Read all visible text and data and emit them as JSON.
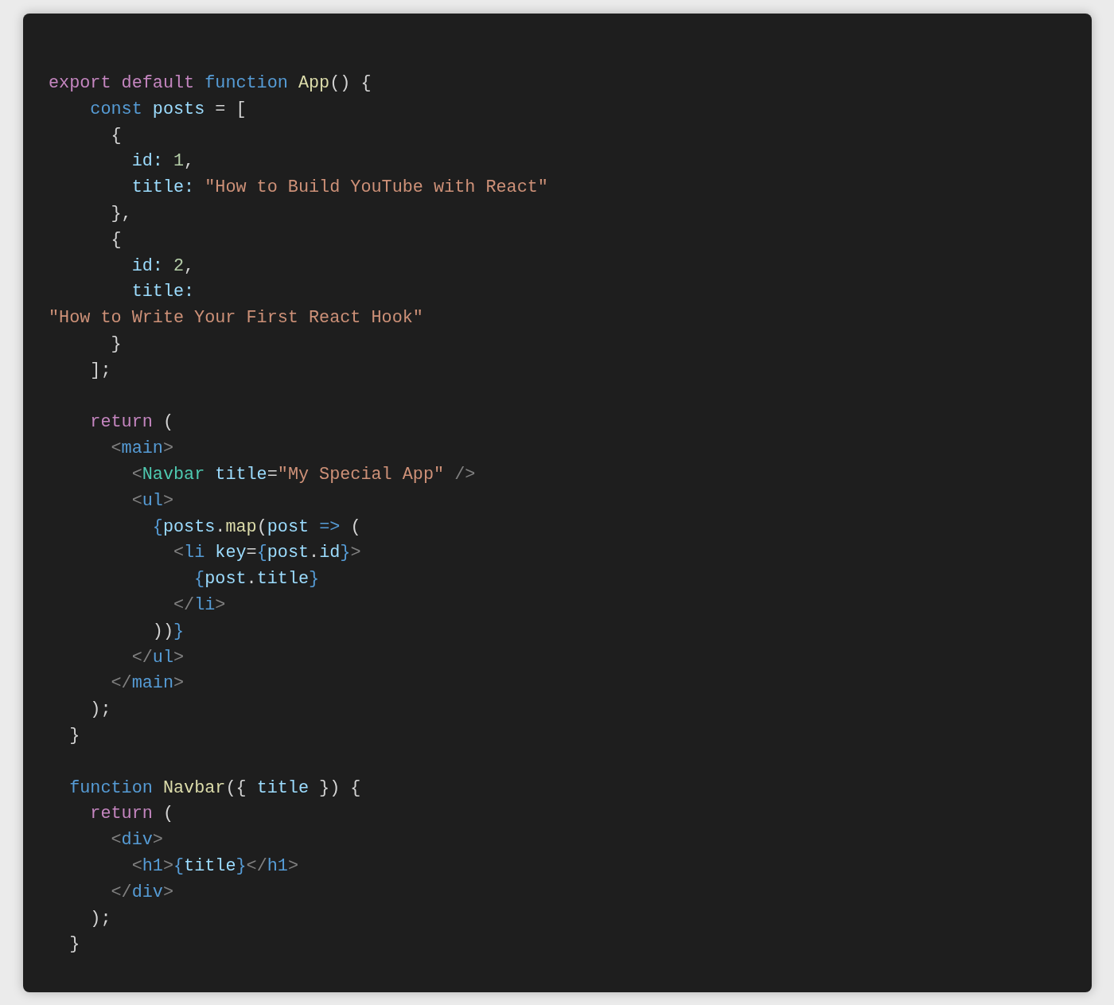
{
  "code_lines": [
    {
      "tokens": [
        {
          "kind": "kw",
          "text": "export default "
        },
        {
          "kind": "decl",
          "text": "function "
        },
        {
          "kind": "fn",
          "text": "App"
        },
        {
          "kind": "punc",
          "text": "() {"
        }
      ]
    },
    {
      "tokens": [
        {
          "kind": "decl",
          "text": "    const "
        },
        {
          "kind": "var",
          "text": "posts"
        },
        {
          "kind": "punc",
          "text": " = ["
        }
      ]
    },
    {
      "tokens": [
        {
          "kind": "punc",
          "text": "      {"
        }
      ]
    },
    {
      "tokens": [
        {
          "kind": "var",
          "text": "        id: "
        },
        {
          "kind": "num",
          "text": "1"
        },
        {
          "kind": "punc",
          "text": ","
        }
      ]
    },
    {
      "tokens": [
        {
          "kind": "var",
          "text": "        title: "
        },
        {
          "kind": "str",
          "text": "\"How to Build YouTube with React\""
        }
      ]
    },
    {
      "tokens": [
        {
          "kind": "punc",
          "text": "      },"
        }
      ]
    },
    {
      "tokens": [
        {
          "kind": "punc",
          "text": "      {"
        }
      ]
    },
    {
      "tokens": [
        {
          "kind": "var",
          "text": "        id: "
        },
        {
          "kind": "num",
          "text": "2"
        },
        {
          "kind": "punc",
          "text": ","
        }
      ]
    },
    {
      "tokens": [
        {
          "kind": "var",
          "text": "        title:"
        }
      ]
    },
    {
      "tokens": [
        {
          "kind": "str",
          "text": "\"How to Write Your First React Hook\""
        }
      ]
    },
    {
      "tokens": [
        {
          "kind": "punc",
          "text": "      }"
        }
      ]
    },
    {
      "tokens": [
        {
          "kind": "punc",
          "text": "    ];"
        }
      ]
    },
    {
      "blank_line_before": true,
      "tokens": [
        {
          "kind": "kw",
          "text": "    return"
        },
        {
          "kind": "punc",
          "text": " ("
        }
      ]
    },
    {
      "tokens": [
        {
          "kind": "tagp",
          "text": "      <"
        },
        {
          "kind": "tag",
          "text": "main"
        },
        {
          "kind": "tagp",
          "text": ">"
        }
      ]
    },
    {
      "tokens": [
        {
          "kind": "tagp",
          "text": "        <"
        },
        {
          "kind": "comp",
          "text": "Navbar"
        },
        {
          "kind": "attr",
          "text": " title"
        },
        {
          "kind": "punc",
          "text": "="
        },
        {
          "kind": "str",
          "text": "\"My Special App\""
        },
        {
          "kind": "tagp",
          "text": " />"
        }
      ]
    },
    {
      "tokens": [
        {
          "kind": "tagp",
          "text": "        <"
        },
        {
          "kind": "tag",
          "text": "ul"
        },
        {
          "kind": "tagp",
          "text": ">"
        }
      ]
    },
    {
      "tokens": [
        {
          "kind": "brace",
          "text": "          {"
        },
        {
          "kind": "var",
          "text": "posts"
        },
        {
          "kind": "punc",
          "text": "."
        },
        {
          "kind": "fn",
          "text": "map"
        },
        {
          "kind": "punc",
          "text": "("
        },
        {
          "kind": "var",
          "text": "post"
        },
        {
          "kind": "decl",
          "text": " =>"
        },
        {
          "kind": "punc",
          "text": " ("
        }
      ]
    },
    {
      "tokens": [
        {
          "kind": "tagp",
          "text": "            <"
        },
        {
          "kind": "tag",
          "text": "li"
        },
        {
          "kind": "attr",
          "text": " key"
        },
        {
          "kind": "punc",
          "text": "="
        },
        {
          "kind": "brace",
          "text": "{"
        },
        {
          "kind": "var",
          "text": "post"
        },
        {
          "kind": "punc",
          "text": "."
        },
        {
          "kind": "var",
          "text": "id"
        },
        {
          "kind": "brace",
          "text": "}"
        },
        {
          "kind": "tagp",
          "text": ">"
        }
      ]
    },
    {
      "tokens": [
        {
          "kind": "brace",
          "text": "              {"
        },
        {
          "kind": "var",
          "text": "post"
        },
        {
          "kind": "punc",
          "text": "."
        },
        {
          "kind": "var",
          "text": "title"
        },
        {
          "kind": "brace",
          "text": "}"
        }
      ]
    },
    {
      "tokens": [
        {
          "kind": "tagp",
          "text": "            </"
        },
        {
          "kind": "tag",
          "text": "li"
        },
        {
          "kind": "tagp",
          "text": ">"
        }
      ]
    },
    {
      "tokens": [
        {
          "kind": "punc",
          "text": "          ))"
        },
        {
          "kind": "brace",
          "text": "}"
        }
      ]
    },
    {
      "tokens": [
        {
          "kind": "tagp",
          "text": "        </"
        },
        {
          "kind": "tag",
          "text": "ul"
        },
        {
          "kind": "tagp",
          "text": ">"
        }
      ]
    },
    {
      "tokens": [
        {
          "kind": "tagp",
          "text": "      </"
        },
        {
          "kind": "tag",
          "text": "main"
        },
        {
          "kind": "tagp",
          "text": ">"
        }
      ]
    },
    {
      "tokens": [
        {
          "kind": "punc",
          "text": "    );"
        }
      ]
    },
    {
      "tokens": [
        {
          "kind": "punc",
          "text": "  }"
        }
      ]
    },
    {
      "blank_line_before": true,
      "tokens": [
        {
          "kind": "decl",
          "text": "  function "
        },
        {
          "kind": "fn",
          "text": "Navbar"
        },
        {
          "kind": "punc",
          "text": "({ "
        },
        {
          "kind": "var",
          "text": "title"
        },
        {
          "kind": "punc",
          "text": " }) {"
        }
      ]
    },
    {
      "tokens": [
        {
          "kind": "kw",
          "text": "    return"
        },
        {
          "kind": "punc",
          "text": " ("
        }
      ]
    },
    {
      "tokens": [
        {
          "kind": "tagp",
          "text": "      <"
        },
        {
          "kind": "tag",
          "text": "div"
        },
        {
          "kind": "tagp",
          "text": ">"
        }
      ]
    },
    {
      "tokens": [
        {
          "kind": "tagp",
          "text": "        <"
        },
        {
          "kind": "tag",
          "text": "h1"
        },
        {
          "kind": "tagp",
          "text": ">"
        },
        {
          "kind": "brace",
          "text": "{"
        },
        {
          "kind": "var",
          "text": "title"
        },
        {
          "kind": "brace",
          "text": "}"
        },
        {
          "kind": "tagp",
          "text": "</"
        },
        {
          "kind": "tag",
          "text": "h1"
        },
        {
          "kind": "tagp",
          "text": ">"
        }
      ]
    },
    {
      "tokens": [
        {
          "kind": "tagp",
          "text": "      </"
        },
        {
          "kind": "tag",
          "text": "div"
        },
        {
          "kind": "tagp",
          "text": ">"
        }
      ]
    },
    {
      "tokens": [
        {
          "kind": "punc",
          "text": "    );"
        }
      ]
    },
    {
      "tokens": [
        {
          "kind": "punc",
          "text": "  }"
        }
      ]
    }
  ]
}
